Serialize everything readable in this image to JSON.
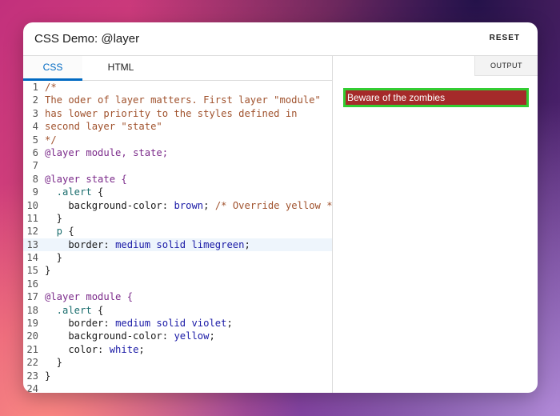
{
  "window": {
    "title": "CSS Demo: @layer",
    "reset_label": "RESET"
  },
  "editor": {
    "tabs": [
      {
        "label": "CSS",
        "active": true
      },
      {
        "label": "HTML",
        "active": false
      }
    ],
    "active_line": 13,
    "lines": [
      [
        {
          "t": "/*",
          "c": "comment"
        }
      ],
      [
        {
          "t": "The oder of layer matters. First layer \"module\"",
          "c": "comment"
        }
      ],
      [
        {
          "t": "has lower priority to the styles defined in",
          "c": "comment"
        }
      ],
      [
        {
          "t": "second layer \"state\"",
          "c": "comment"
        }
      ],
      [
        {
          "t": "*/",
          "c": "comment"
        }
      ],
      [
        {
          "t": "@layer",
          "c": "at"
        },
        {
          "t": " module, state;",
          "c": "at"
        }
      ],
      [],
      [
        {
          "t": "@layer",
          "c": "at"
        },
        {
          "t": " state {",
          "c": "at"
        }
      ],
      [
        {
          "t": "  .alert",
          "c": "sel"
        },
        {
          "t": " {",
          "c": "prop"
        }
      ],
      [
        {
          "t": "    background-color: ",
          "c": "prop"
        },
        {
          "t": "brown",
          "c": "val"
        },
        {
          "t": "; ",
          "c": "prop"
        },
        {
          "t": "/* Override yellow */",
          "c": "comment"
        }
      ],
      [
        {
          "t": "  }",
          "c": "prop"
        }
      ],
      [
        {
          "t": "  p",
          "c": "sel"
        },
        {
          "t": " {",
          "c": "prop"
        }
      ],
      [
        {
          "t": "    border: ",
          "c": "prop"
        },
        {
          "t": "medium solid limegreen",
          "c": "val"
        },
        {
          "t": ";",
          "c": "prop"
        }
      ],
      [
        {
          "t": "  }",
          "c": "prop"
        }
      ],
      [
        {
          "t": "}",
          "c": "prop"
        }
      ],
      [],
      [
        {
          "t": "@layer",
          "c": "at"
        },
        {
          "t": " module {",
          "c": "at"
        }
      ],
      [
        {
          "t": "  .alert",
          "c": "sel"
        },
        {
          "t": " {",
          "c": "prop"
        }
      ],
      [
        {
          "t": "    border: ",
          "c": "prop"
        },
        {
          "t": "medium solid violet",
          "c": "val"
        },
        {
          "t": ";",
          "c": "prop"
        }
      ],
      [
        {
          "t": "    background-color: ",
          "c": "prop"
        },
        {
          "t": "yellow",
          "c": "val"
        },
        {
          "t": ";",
          "c": "prop"
        }
      ],
      [
        {
          "t": "    color: ",
          "c": "prop"
        },
        {
          "t": "white",
          "c": "val"
        },
        {
          "t": ";",
          "c": "prop"
        }
      ],
      [
        {
          "t": "  }",
          "c": "prop"
        }
      ],
      [
        {
          "t": "}",
          "c": "prop"
        }
      ],
      []
    ]
  },
  "output": {
    "label": "OUTPUT",
    "alert_text": "Beware of the zombies",
    "alert_background": "#a52a2a",
    "alert_border": "#32cd32"
  }
}
